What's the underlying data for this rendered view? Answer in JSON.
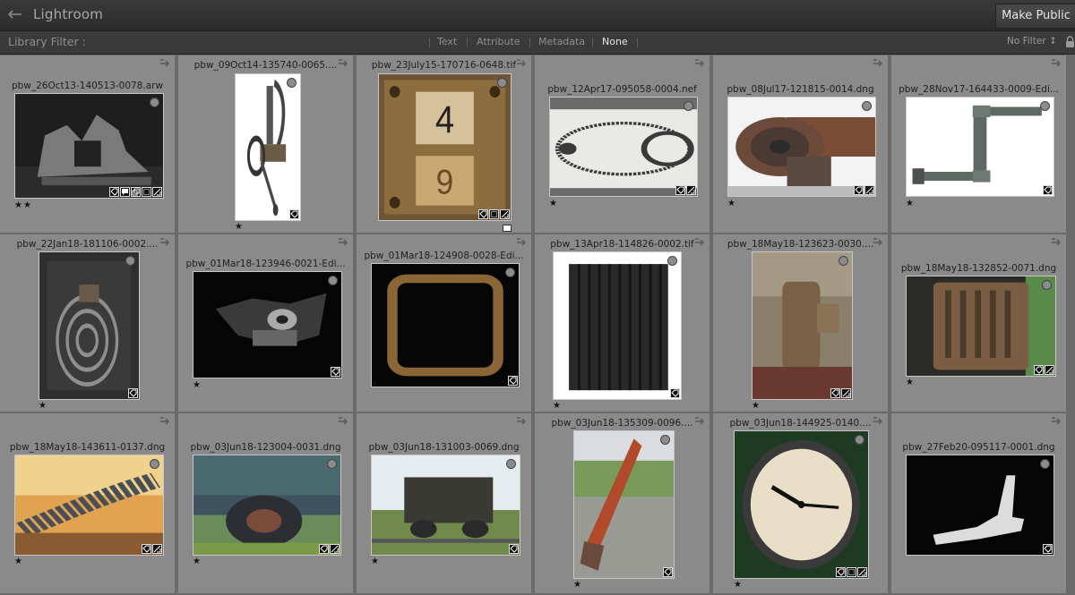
{
  "app": {
    "title": "Lightroom",
    "make_public_label": "Make Public"
  },
  "filter_bar": {
    "label": "Library Filter :",
    "tabs": [
      {
        "label": "Text",
        "active": false
      },
      {
        "label": "Attribute",
        "active": false
      },
      {
        "label": "Metadata",
        "active": false
      },
      {
        "label": "None",
        "active": true
      }
    ],
    "preset": "No Filter ↕"
  },
  "colors": {
    "cell_bg": "#8a8a8a",
    "grid_bg": "#6b6b6b",
    "toolbar_bg": "#2f2f2f"
  },
  "photos": [
    {
      "filename": "pbw_26Oct13-140513-0078.arw",
      "stars": "★★",
      "badges": [
        "keyword-icon",
        "comment-icon",
        "copy-icon",
        "crop-icon",
        "develop-icon"
      ],
      "subject": "dark-metal"
    },
    {
      "filename": "pbw_09Oct14-135740-0065....",
      "stars": "★",
      "badges": [
        "keyword-icon"
      ],
      "subject": "lever-white"
    },
    {
      "filename": "pbw_23July15-170716-0648.tif",
      "stars": "",
      "badges": [
        "keyword-icon",
        "crop-icon",
        "develop-icon"
      ],
      "subject": "rusty-plate"
    },
    {
      "filename": "pbw_12Apr17-095058-0004.nef",
      "stars": "★",
      "badges": [
        "keyword-icon",
        "develop-icon"
      ],
      "subject": "chain-white"
    },
    {
      "filename": "pbw_08Jul17-121815-0014.dng",
      "stars": "★",
      "badges": [
        "keyword-icon",
        "develop-icon"
      ],
      "subject": "gear-rust"
    },
    {
      "filename": "pbw_28Nov17-164433-0009-Edi...",
      "stars": "★",
      "badges": [
        "keyword-icon"
      ],
      "subject": "pipe-white"
    },
    {
      "filename": "pbw_22Jan18-181106-0002....",
      "stars": "★",
      "badges": [
        "keyword-icon"
      ],
      "subject": "coil-dark"
    },
    {
      "filename": "pbw_01Mar18-123946-0021-Edi...",
      "stars": "★",
      "badges": [
        "keyword-icon"
      ],
      "subject": "mechanism-black"
    },
    {
      "filename": "pbw_01Mar18-124908-0028-Edi...",
      "stars": "★",
      "badges": [
        "keyword-icon"
      ],
      "subject": "frame-black"
    },
    {
      "filename": "pbw_13Apr18-114826-0002.tif",
      "stars": "★",
      "badges": [
        "keyword-icon"
      ],
      "subject": "bellows-white"
    },
    {
      "filename": "pbw_18May18-123623-0030....",
      "stars": "★",
      "badges": [
        "keyword-icon",
        "develop-icon"
      ],
      "subject": "tank-rust"
    },
    {
      "filename": "pbw_18May18-132852-0071.dng",
      "stars": "★",
      "badges": [
        "keyword-icon",
        "develop-icon"
      ],
      "subject": "grille-rust"
    },
    {
      "filename": "pbw_18May18-143611-0137.dng",
      "stars": "★",
      "badges": [
        "keyword-icon",
        "develop-icon"
      ],
      "subject": "hose-orange"
    },
    {
      "filename": "pbw_03Jun18-123004-0031.dng",
      "stars": "★",
      "badges": [
        "keyword-icon",
        "develop-icon"
      ],
      "subject": "wheel-green"
    },
    {
      "filename": "pbw_03Jun18-131003-0069.dng",
      "stars": "★",
      "badges": [
        "keyword-icon"
      ],
      "subject": "cart-sky"
    },
    {
      "filename": "pbw_03Jun18-135309-0096....",
      "stars": "★",
      "badges": [
        "keyword-icon"
      ],
      "subject": "excavator"
    },
    {
      "filename": "pbw_03Jun18-144925-0140....",
      "stars": "★",
      "badges": [
        "keyword-icon",
        "crop-icon",
        "develop-icon"
      ],
      "subject": "clock-green"
    },
    {
      "filename": "pbw_27Feb20-095117-0001.dng",
      "stars": "",
      "badges": [
        "keyword-icon"
      ],
      "subject": "arm-black"
    }
  ]
}
